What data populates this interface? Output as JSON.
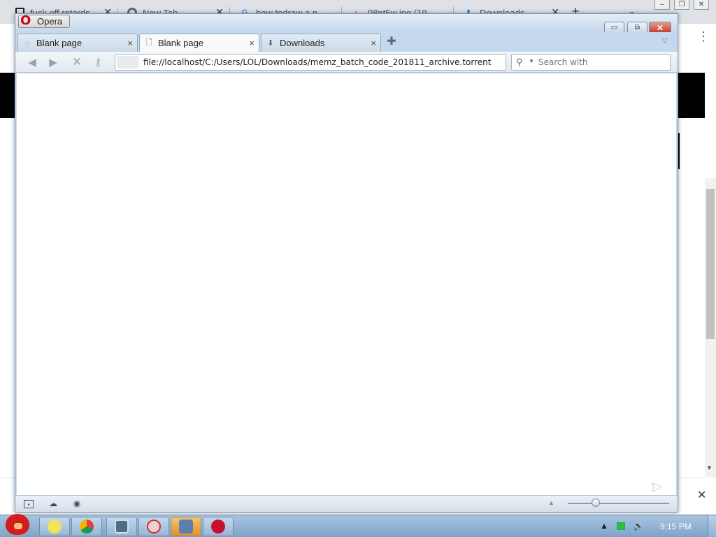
{
  "background_browser": {
    "tabs": [
      {
        "title": "fuck off retards",
        "icon": "trash-icon"
      },
      {
        "title": "New Tab",
        "icon": "chrome-icon"
      },
      {
        "title": "how todraw a n",
        "icon": "google-icon"
      },
      {
        "title": "08nt5w.jpg (19",
        "icon": "image-icon"
      },
      {
        "title": "Downloads",
        "icon": "download-arrow-icon"
      }
    ],
    "new_tab_symbol": "+",
    "tab_menu_symbol": "⌄"
  },
  "opera": {
    "menu_label": "Opera",
    "tabs": [
      {
        "title": "Blank page",
        "icon": "loading-icon",
        "close": "×"
      },
      {
        "title": "Blank page",
        "icon": "page-icon",
        "close": "×"
      },
      {
        "title": "Downloads",
        "icon": "downloads-icon",
        "close": "×"
      }
    ],
    "address": "file://localhost/C:/Users/LOL/Downloads/memz_batch_code_201811_archive.torrent",
    "search_placeholder": "Search with"
  },
  "taskbar": {
    "clock": "9:15 PM",
    "colors": {
      "bar": "#8fb2d4",
      "active_button": "#f0a840"
    }
  },
  "colors": {
    "opera_frame": "#c5d9ee",
    "close_button": "#c0392b"
  }
}
